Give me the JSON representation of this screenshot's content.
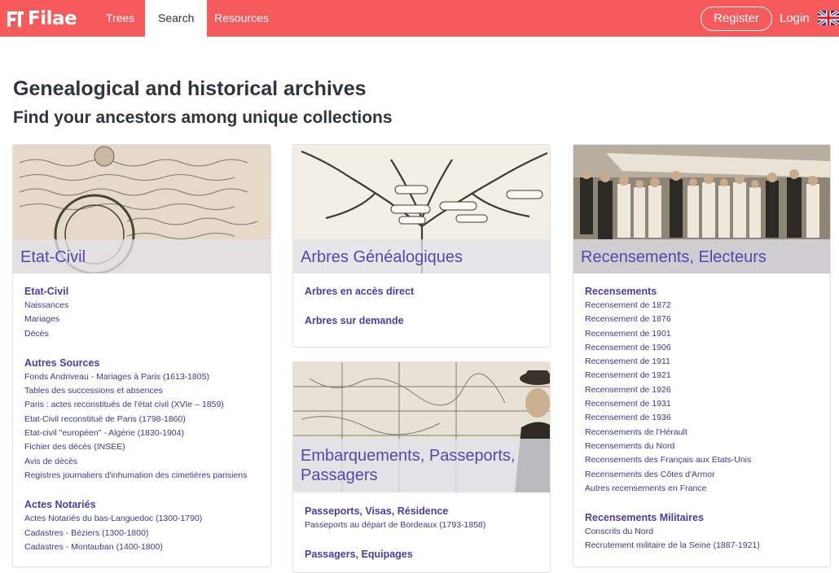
{
  "nav": {
    "logo_text": "Filae",
    "items": [
      "Trees",
      "Search",
      "Resources"
    ],
    "active": "Search",
    "register_label": "Register",
    "login_label": "Login",
    "language_icon": "uk-flag-icon",
    "accent_color": "#f65a5b"
  },
  "page": {
    "title": "Genealogical and historical archives",
    "subtitle": "Find your ancestors among unique collections"
  },
  "cards": {
    "etat_civil": {
      "title": "Etat-Civil",
      "sections": [
        {
          "heading": "Etat-Civil",
          "links": [
            "Naissances",
            "Mariages",
            "Décès"
          ]
        },
        {
          "heading": "Autres Sources",
          "links": [
            "Fonds Andriveau - Mariages à Paris (1613-1805)",
            "Tables des successions et absences",
            "Paris : actes reconstitués de l'état civil (XVIe – 1859)",
            "Etat-Civil reconstitué de Paris (1798-1860)",
            "Etat-civil \"européen\" - Algérie (1830-1904)",
            "Fichier des décès (INSEE)",
            "Avis de décès",
            "Registres journaliers d'inhumation des cimetières parisiens"
          ]
        },
        {
          "heading": "Actes Notariés",
          "links": [
            "Actes Notariés du bas-Languedoc (1300-1790)",
            "Cadastres - Béziers (1300-1800)",
            "Cadastres - Montauban (1400-1800)"
          ]
        }
      ]
    },
    "arbres": {
      "title": "Arbres Généalogiques",
      "sections": [
        {
          "heading": "Arbres en accès direct",
          "links": []
        },
        {
          "heading": "Arbres sur demande",
          "links": []
        }
      ]
    },
    "embarquements": {
      "title_line1": "Embarquements, Passeports,",
      "title_line2": "Passagers",
      "sections": [
        {
          "heading": "Passeports, Visas, Résidence",
          "links": [
            "Passeports au départ de Bordeaux (1793-1858)"
          ]
        },
        {
          "heading": "Passagers, Equipages",
          "links": []
        }
      ]
    },
    "recensements": {
      "title": "Recensements, Electeurs",
      "sections": [
        {
          "heading": "Recensements",
          "links": [
            "Recensement de 1872",
            "Recensement de 1876",
            "Recensement de 1901",
            "Recensement de 1906",
            "Recensement de 1911",
            "Recensement de 1921",
            "Recensement de 1926",
            "Recensement de 1931",
            "Recensement de 1936",
            "Recensements de l'Hérault",
            "Recensements du Nord",
            "Recensements des Français aux Etats-Unis",
            "Recensements des Côtes d'Armor",
            "Autres recensements en France"
          ]
        },
        {
          "heading": "Recensements Militaires",
          "links": [
            "Conscrits du Nord",
            "Recrutement militaire de la Seine (1887-1921)"
          ]
        }
      ]
    }
  }
}
